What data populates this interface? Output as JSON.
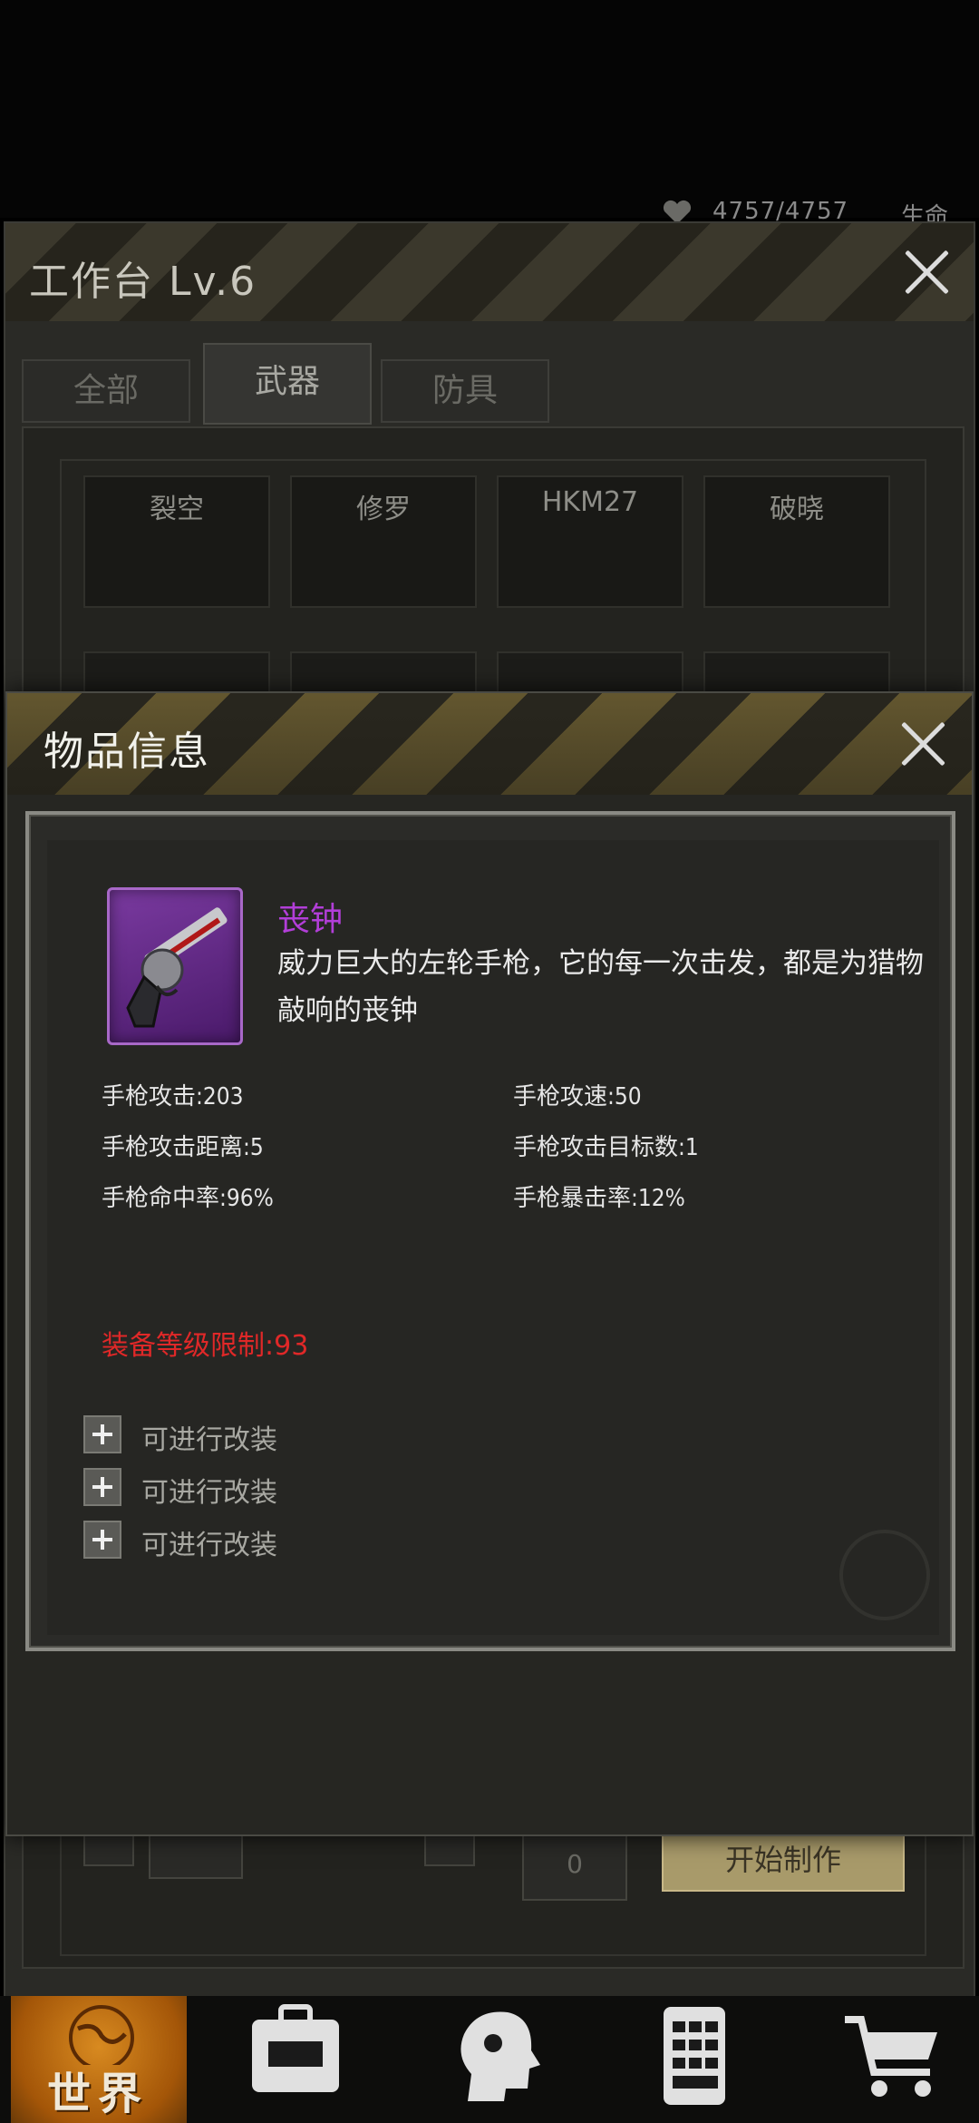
{
  "status_bar": {
    "hp": "4757/4757",
    "life_label": "生命"
  },
  "workbench": {
    "title": "工作台 Lv.6",
    "tabs": [
      "全部",
      "武器",
      "防具"
    ],
    "active_tab": "武器",
    "slots": [
      "裂空",
      "修罗",
      "HKM27",
      "破晓"
    ],
    "quantity": "0",
    "start_button": "开始制作"
  },
  "bottom_nav": {
    "world_label": "世界"
  },
  "item_info": {
    "title": "物品信息",
    "item_name": "丧钟",
    "item_desc": "威力巨大的左轮手枪，它的每一次击发，都是为猎物敲响的丧钟",
    "stats": {
      "pistol_attack": "手枪攻击:203",
      "pistol_speed": "手枪攻速:50",
      "pistol_range": "手枪攻击距离:5",
      "pistol_targets": "手枪攻击目标数:1",
      "pistol_hit": "手枪命中率:96%",
      "pistol_crit": "手枪暴击率:12%"
    },
    "level_req": "装备等级限制:93",
    "mods": [
      "可进行改装",
      "可进行改装",
      "可进行改装"
    ],
    "colors": {
      "name": "#b23ed8",
      "requirement": "#e02828"
    }
  }
}
